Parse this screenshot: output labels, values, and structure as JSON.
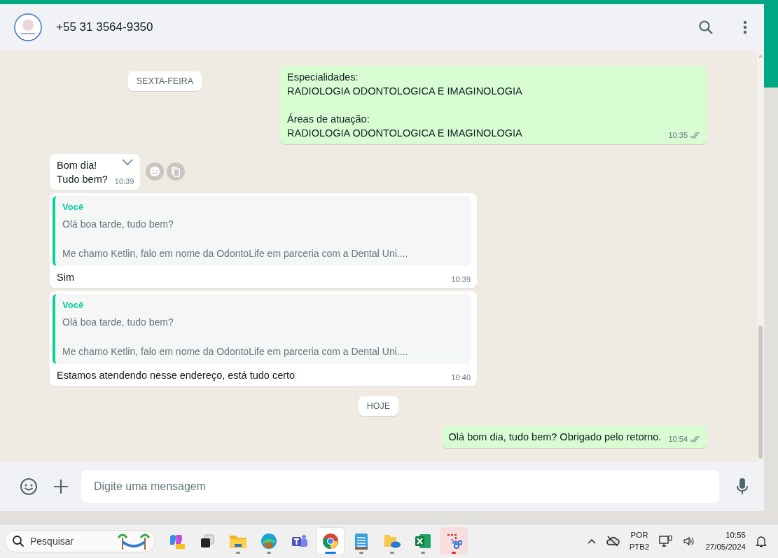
{
  "chat_header": {
    "contact": "+55 31 3564-9350"
  },
  "sticky_date": "SEXTA-FEIRA",
  "messages": [
    {
      "kind": "text",
      "outgoing": true,
      "paragraphs": [
        "Especialidades:\nRADIOLOGIA ODONTOLOGICA E IMAGINOLOGIA",
        "Áreas de atuação:\nRADIOLOGIA ODONTOLOGICA E IMAGINOLOGIA"
      ],
      "time": "10:35",
      "read": false
    },
    {
      "kind": "text",
      "outgoing": false,
      "paragraphs": [
        "Bom dia!\nTudo bem?"
      ],
      "time": "10:39",
      "hovered": true
    },
    {
      "kind": "reply",
      "outgoing": false,
      "quote": {
        "author": "Você",
        "paragraphs": [
          "Olá boa tarde, tudo bem?",
          "Me chamo Ketlin, falo em nome da OdontoLife em parceria com a Dental Uni...."
        ]
      },
      "paragraphs": [
        "Sim"
      ],
      "time": "10:39"
    },
    {
      "kind": "reply",
      "outgoing": false,
      "quote": {
        "author": "Você",
        "paragraphs": [
          "Olá boa tarde, tudo bem?",
          "Me chamo Ketlin, falo em nome da OdontoLife em parceria com a Dental Uni...."
        ]
      },
      "paragraphs": [
        "Estamos atendendo nesse endereço, está tudo certo"
      ],
      "time": "10:40"
    },
    {
      "kind": "date",
      "label": "HOJE"
    },
    {
      "kind": "text",
      "outgoing": true,
      "paragraphs": [
        "Olá bom dia, tudo bem? Obrigado pelo retorno."
      ],
      "time": "10:54",
      "read": false
    }
  ],
  "composer": {
    "placeholder": "Digite uma mensagem"
  },
  "taskbar": {
    "search": {
      "placeholder": "Pesquisar"
    },
    "apps": [
      {
        "kind": "copilot",
        "selected": false,
        "running": false
      },
      {
        "kind": "taskview",
        "selected": false,
        "running": false
      },
      {
        "kind": "folder",
        "selected": false,
        "running": true
      },
      {
        "kind": "edge",
        "selected": false,
        "running": true
      },
      {
        "kind": "teams",
        "selected": false,
        "running": false
      },
      {
        "kind": "chrome",
        "selected": true,
        "running": true
      },
      {
        "kind": "notepad",
        "selected": false,
        "running": true
      },
      {
        "kind": "onedrive",
        "selected": false,
        "running": true
      },
      {
        "kind": "excel",
        "selected": false,
        "running": true
      },
      {
        "kind": "snip",
        "selected": false,
        "running": true,
        "attention": true
      }
    ],
    "tray": {
      "language": "POR",
      "layout": "PTB2",
      "time": "10:55",
      "date": "27/05/2024"
    }
  }
}
